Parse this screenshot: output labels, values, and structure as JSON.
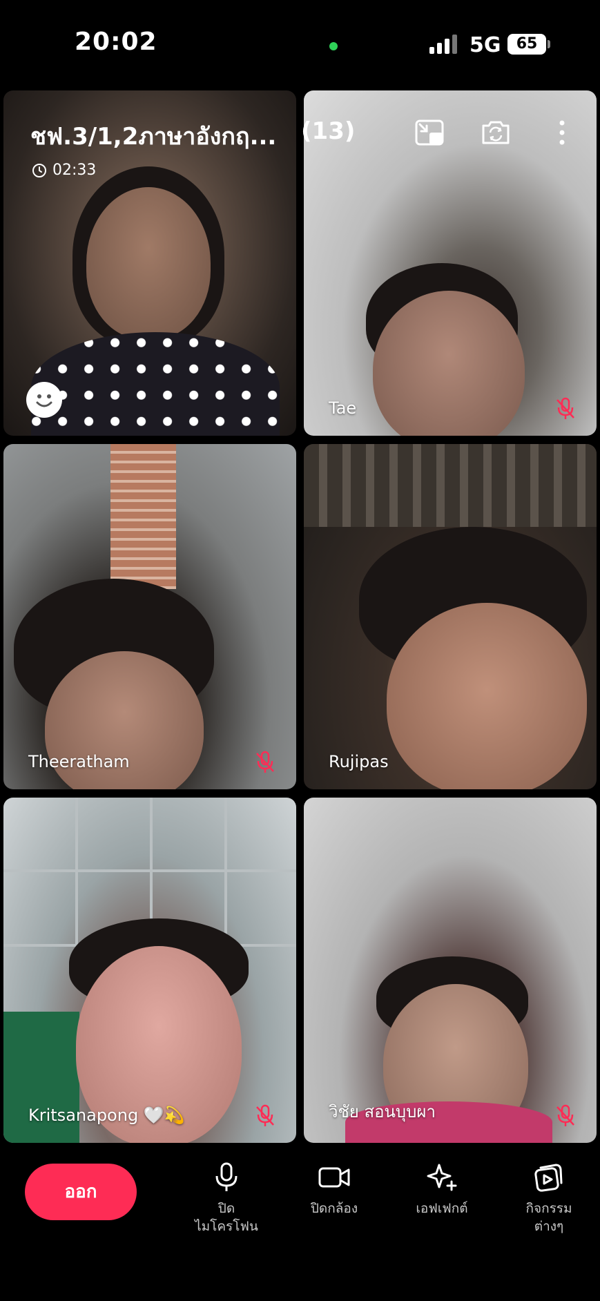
{
  "status_bar": {
    "time": "20:02",
    "network": "5G",
    "battery": "65"
  },
  "call": {
    "title": "ชฟ.3/1,2ภาษาอังกฤ...",
    "participant_count": "(13)",
    "duration": "02:33"
  },
  "tiles": [
    {
      "name": ""
    },
    {
      "name": "Tae",
      "muted": true
    },
    {
      "name": "Theeratham",
      "muted": true
    },
    {
      "name": "Rujipas",
      "muted": false
    },
    {
      "name": "Kritsanapong 🤍💫",
      "muted": true
    },
    {
      "name": "วิชัย   สอนบุบผา",
      "muted": true
    }
  ],
  "controls": {
    "leave": "ออก",
    "mic_line1": "ปิด",
    "mic_line2": "ไมโครโฟน",
    "camera": "ปิดกล้อง",
    "effects": "เอฟเฟกต์",
    "activities_line1": "กิจกรรม",
    "activities_line2": "ต่างๆ"
  },
  "colors": {
    "accent": "#fe2c55",
    "status_dot": "#2fd158",
    "muted_mic": "#fe2c55"
  },
  "icons": [
    "pip-icon",
    "flip-camera-icon",
    "more-icon",
    "smiley-icon",
    "clock-icon",
    "mic-muted-icon",
    "mic-icon",
    "video-icon",
    "sparkle-icon",
    "activities-icon"
  ]
}
